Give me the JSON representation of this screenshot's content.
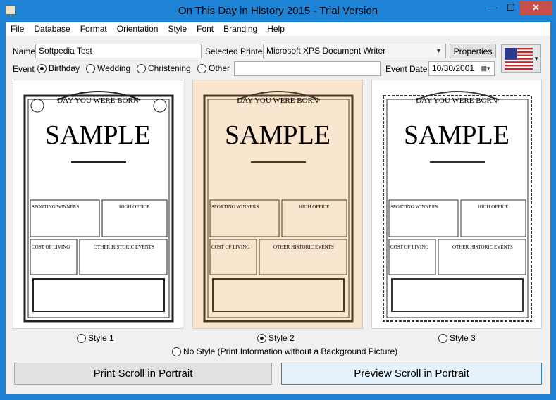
{
  "window": {
    "title": "On This Day in History 2015 - Trial Version",
    "controls": {
      "minimize": "—",
      "maximize": "☐",
      "close": "✕"
    }
  },
  "menu": [
    "File",
    "Database",
    "Format",
    "Orientation",
    "Style",
    "Font",
    "Branding",
    "Help"
  ],
  "form": {
    "name_label": "Name",
    "name_value": "Softpedia Test",
    "printer_label": "Selected Printer",
    "printer_value": "Microsoft XPS Document Writer",
    "properties_label": "Properties",
    "event_label": "Event",
    "events": [
      {
        "label": "Birthday",
        "selected": true
      },
      {
        "label": "Wedding",
        "selected": false
      },
      {
        "label": "Christening",
        "selected": false
      },
      {
        "label": "Other",
        "selected": false
      }
    ],
    "other_value": "",
    "event_date_label": "Event Date",
    "event_date_value": "10/30/2001"
  },
  "flag": {
    "icon": "us-flag-icon"
  },
  "styles": [
    {
      "label": "Style 1",
      "selected": false,
      "heading": "DAY YOU WERE BORN",
      "sample": "SAMPLE",
      "boxes": [
        "SPORTING WINNERS",
        "HIGH OFFICE",
        "COST OF LIVING",
        "OTHER HISTORIC EVENTS"
      ]
    },
    {
      "label": "Style 2",
      "selected": true,
      "heading": "DAY YOU WERE BORN",
      "sample": "SAMPLE",
      "boxes": [
        "SPORTING WINNERS",
        "HIGH OFFICE",
        "COST OF LIVING",
        "OTHER HISTORIC EVENTS"
      ]
    },
    {
      "label": "Style 3",
      "selected": false,
      "heading": "DAY YOU WERE BORN",
      "sample": "SAMPLE",
      "boxes": [
        "SPORTING WINNERS",
        "HIGH OFFICE",
        "COST OF LIVING",
        "OTHER HISTORIC EVENTS"
      ]
    }
  ],
  "no_style": {
    "label": "No Style (Print Information without a Background Picture)",
    "selected": false
  },
  "actions": {
    "print_label": "Print Scroll in Portrait",
    "preview_label": "Preview Scroll in Portrait"
  },
  "colors": {
    "titlebar": "#1f84d6",
    "selected_card": "#fae6cf",
    "close_button": "#c7504b"
  }
}
